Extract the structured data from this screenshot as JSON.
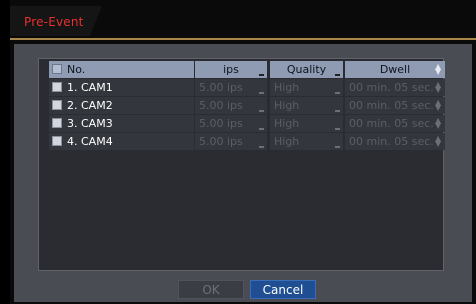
{
  "tab": {
    "title": "Pre-Event"
  },
  "table": {
    "headers": {
      "no": "No.",
      "ips": "ips",
      "quality": "Quality",
      "dwell": "Dwell"
    },
    "rows": [
      {
        "name": "1. CAM1",
        "ips": "5.00 ips",
        "quality": "High",
        "dwell": "00 min. 05 sec."
      },
      {
        "name": "2. CAM2",
        "ips": "5.00 ips",
        "quality": "High",
        "dwell": "00 min. 05 sec."
      },
      {
        "name": "3. CAM3",
        "ips": "5.00 ips",
        "quality": "High",
        "dwell": "00 min. 05 sec."
      },
      {
        "name": "4. CAM4",
        "ips": "5.00 ips",
        "quality": "High",
        "dwell": "00 min. 05 sec."
      }
    ]
  },
  "buttons": {
    "ok": "OK",
    "cancel": "Cancel"
  },
  "colors": {
    "tab_text": "#e8302e",
    "accent_line": "#a9864a",
    "header_bg": "#8e9bb3",
    "cancel_bg": "#1f4e92"
  }
}
